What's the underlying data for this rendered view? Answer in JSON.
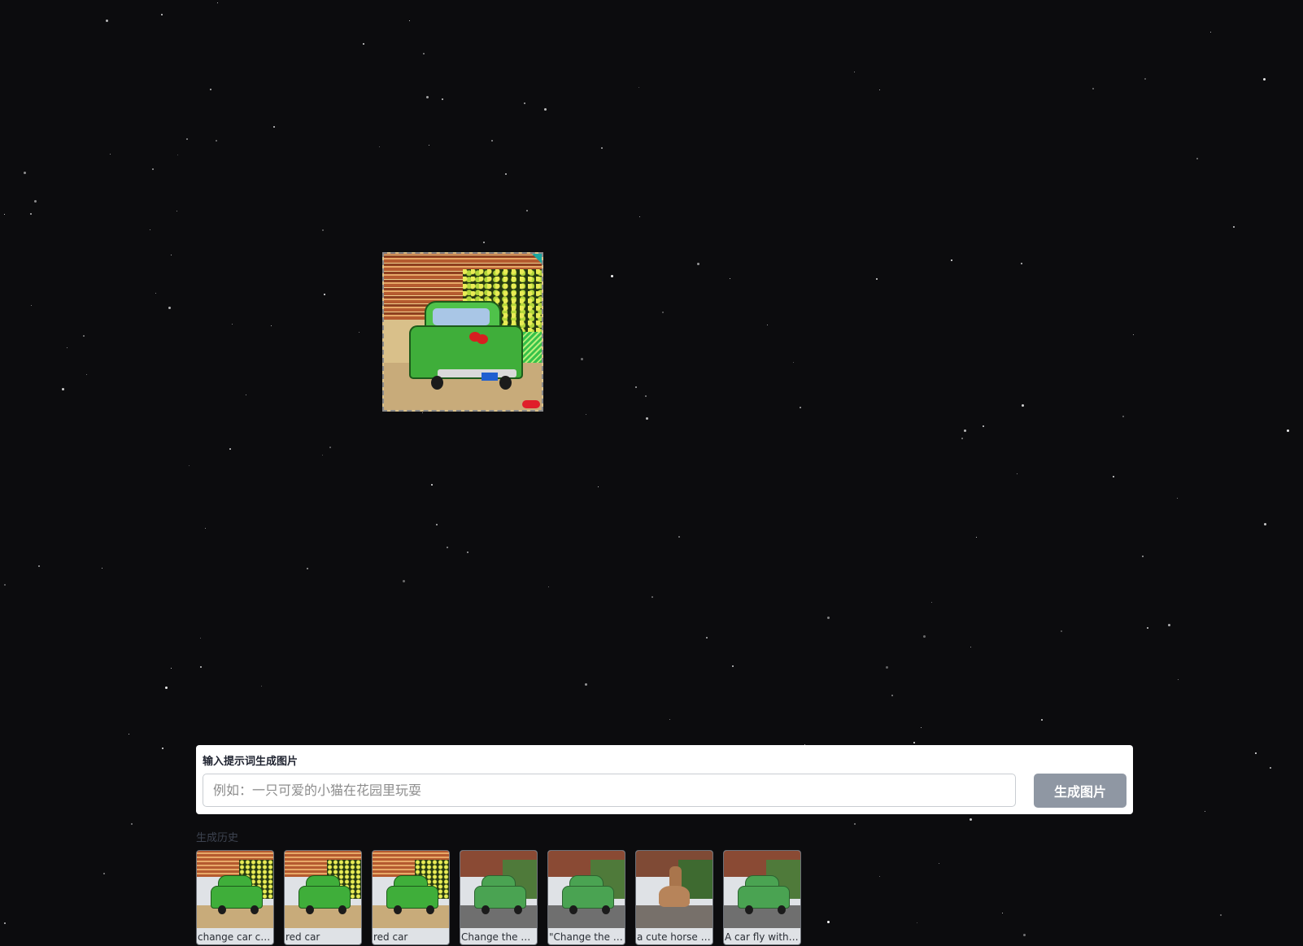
{
  "prompt": {
    "label": "输入提示词生成图片",
    "placeholder": "例如：一只可爱的小猫在花园里玩耍",
    "value": "",
    "button_label": "生成图片"
  },
  "history": {
    "title": "生成历史",
    "items": [
      {
        "caption": "change car col...",
        "style": "pixel"
      },
      {
        "caption": "red car",
        "style": "pixel"
      },
      {
        "caption": "red car",
        "style": "pixel"
      },
      {
        "caption": "Change the kit...",
        "style": "photo"
      },
      {
        "caption": "\"Change the p...",
        "style": "photo"
      },
      {
        "caption": "a cute horse wi...",
        "style": "horse"
      },
      {
        "caption": "A car fly with d...",
        "style": "photo"
      }
    ]
  },
  "colors": {
    "background": "#0c0c0e",
    "panel": "#ffffff",
    "button": "#8f97a3",
    "history_title": "#3d4350"
  }
}
